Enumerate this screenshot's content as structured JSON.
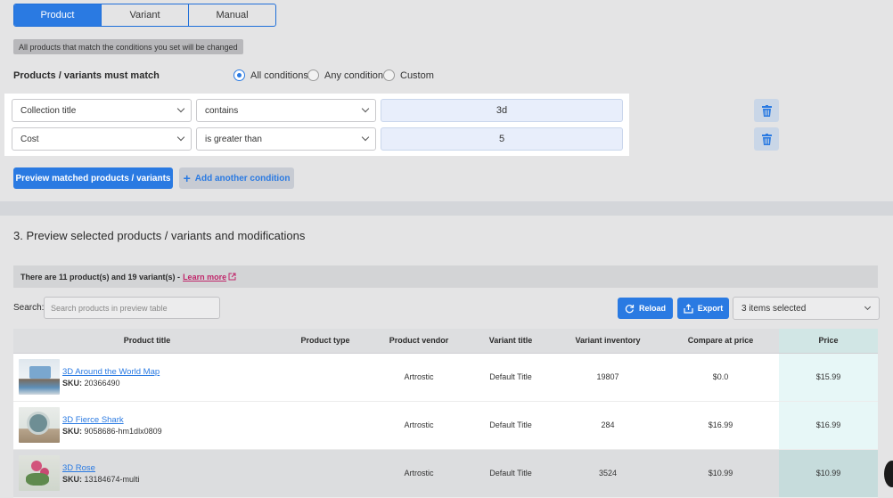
{
  "tabs": [
    "Product",
    "Variant",
    "Manual"
  ],
  "note": "All products that match the conditions you set will be changed",
  "match": {
    "label": "Products / variants must match",
    "options": [
      "All conditions",
      "Any condition",
      "Custom"
    ],
    "selected": "All conditions"
  },
  "conditions": [
    {
      "field": "Collection title",
      "operator": "contains",
      "value": "3d"
    },
    {
      "field": "Cost",
      "operator": "is greater than",
      "value": "5"
    }
  ],
  "buttons": {
    "preview": "Preview matched products / variants",
    "add_condition": "Add another condition",
    "reload": "Reload",
    "export": "Export"
  },
  "section_title": "3. Preview selected products / variants and modifications",
  "info": {
    "text": "There are 11 product(s) and 19 variant(s) -",
    "link": "Learn more"
  },
  "search": {
    "label": "Search:",
    "placeholder": "Search products in preview table"
  },
  "columns_select": "3 items selected",
  "table": {
    "headers": [
      "Product title",
      "Product type",
      "Product vendor",
      "Variant title",
      "Variant inventory",
      "Compare at price",
      "Price"
    ],
    "rows": [
      {
        "title": "3D Around the World Map",
        "sku_label": "SKU:",
        "sku": "20366490",
        "type": "",
        "vendor": "Artrostic",
        "variant": "Default Title",
        "inventory": "19807",
        "compare": "$0.0",
        "price": "$15.99"
      },
      {
        "title": "3D Fierce Shark",
        "sku_label": "SKU:",
        "sku": "9058686-hm1dlx0809",
        "type": "",
        "vendor": "Artrostic",
        "variant": "Default Title",
        "inventory": "284",
        "compare": "$16.99",
        "price": "$16.99"
      },
      {
        "title": "3D Rose",
        "sku_label": "SKU:",
        "sku": "13184674-multi",
        "type": "",
        "vendor": "Artrostic",
        "variant": "Default Title",
        "inventory": "3524",
        "compare": "$10.99",
        "price": "$10.99"
      }
    ]
  },
  "colors": {
    "accent": "#2a7ae2",
    "link_pink": "#c0266a",
    "price_col": "#e7f7f7"
  }
}
